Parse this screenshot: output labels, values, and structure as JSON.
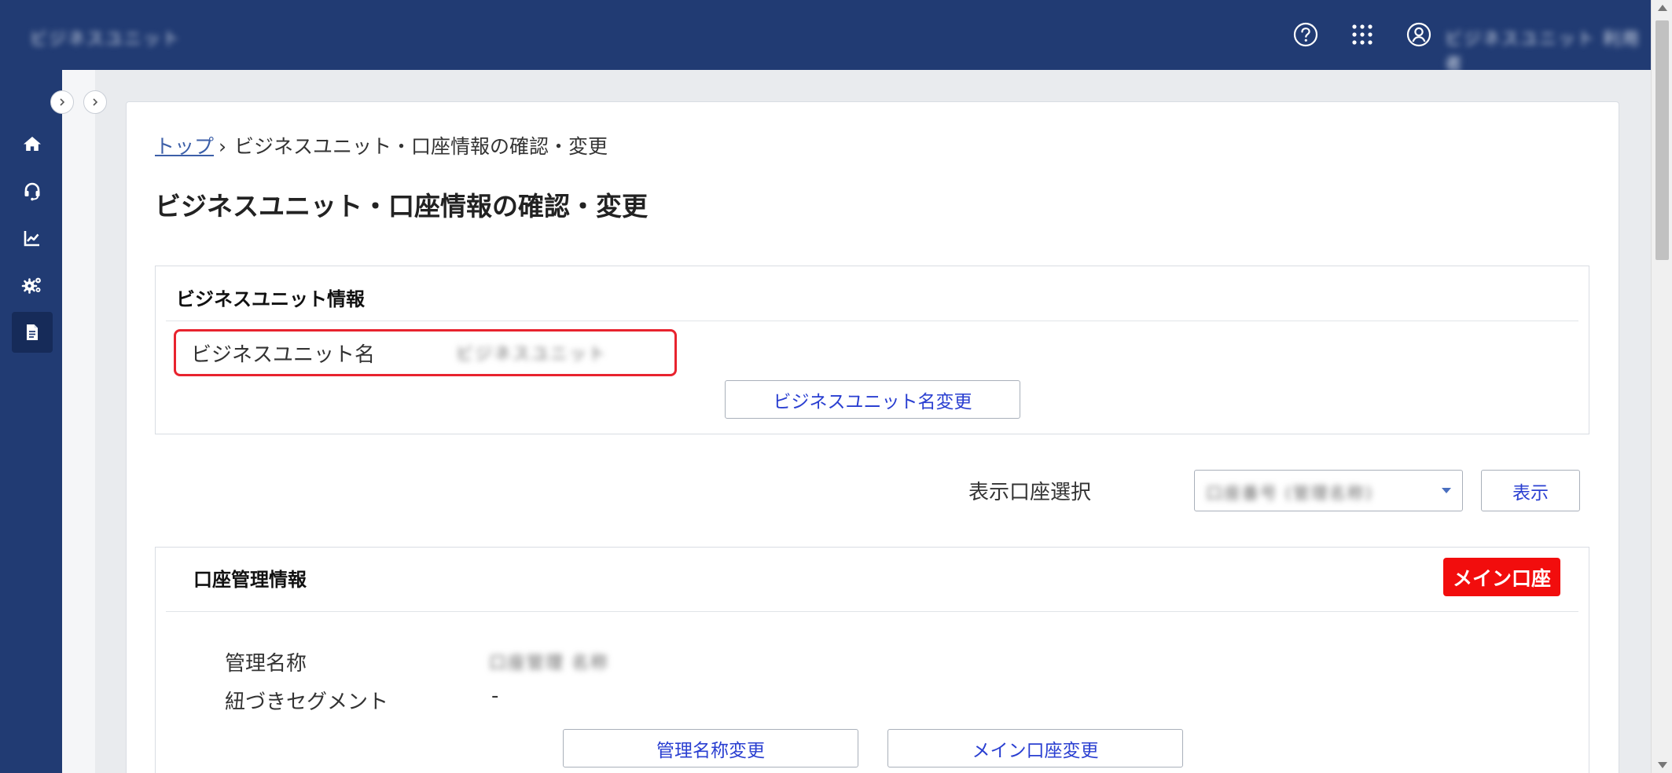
{
  "header": {
    "brand": "ビジネスユニット",
    "user_name": "ビジネスユニット 利用者",
    "icons": [
      "help-icon",
      "apps-grid-icon",
      "user-icon"
    ]
  },
  "sidebar": {
    "items": [
      {
        "icon": "home-icon"
      },
      {
        "icon": "support-headset-icon"
      },
      {
        "icon": "analytics-chart-icon"
      },
      {
        "icon": "settings-gears-icon"
      },
      {
        "icon": "document-icon",
        "active": true
      }
    ]
  },
  "breadcrumb": {
    "home": "トップ",
    "separator": "›",
    "current": "ビジネスユニット・口座情報の確認・変更"
  },
  "page_title": "ビジネスユニット・口座情報の確認・変更",
  "bu_section": {
    "title": "ビジネスユニット情報",
    "name_label": "ビジネスユニット名",
    "name_value": "ビジネスユニット",
    "change_button": "ビジネスユニット名変更"
  },
  "account_select": {
    "label": "表示口座選択",
    "selected": "口座番号 (管理名称)",
    "show_button": "表示"
  },
  "account_section": {
    "title": "口座管理情報",
    "badge": "メイン口座",
    "mgmt_name_label": "管理名称",
    "mgmt_name_value": "口座管理 名称",
    "segment_label": "紐づきセグメント",
    "segment_value": "-",
    "mgmt_name_button": "管理名称変更",
    "main_account_button": "メイン口座変更"
  },
  "colors": {
    "header_bg": "#213b73",
    "badge_red": "#f20d0d",
    "highlight_red": "#e8232e",
    "link_blue": "#2a3fd1"
  }
}
